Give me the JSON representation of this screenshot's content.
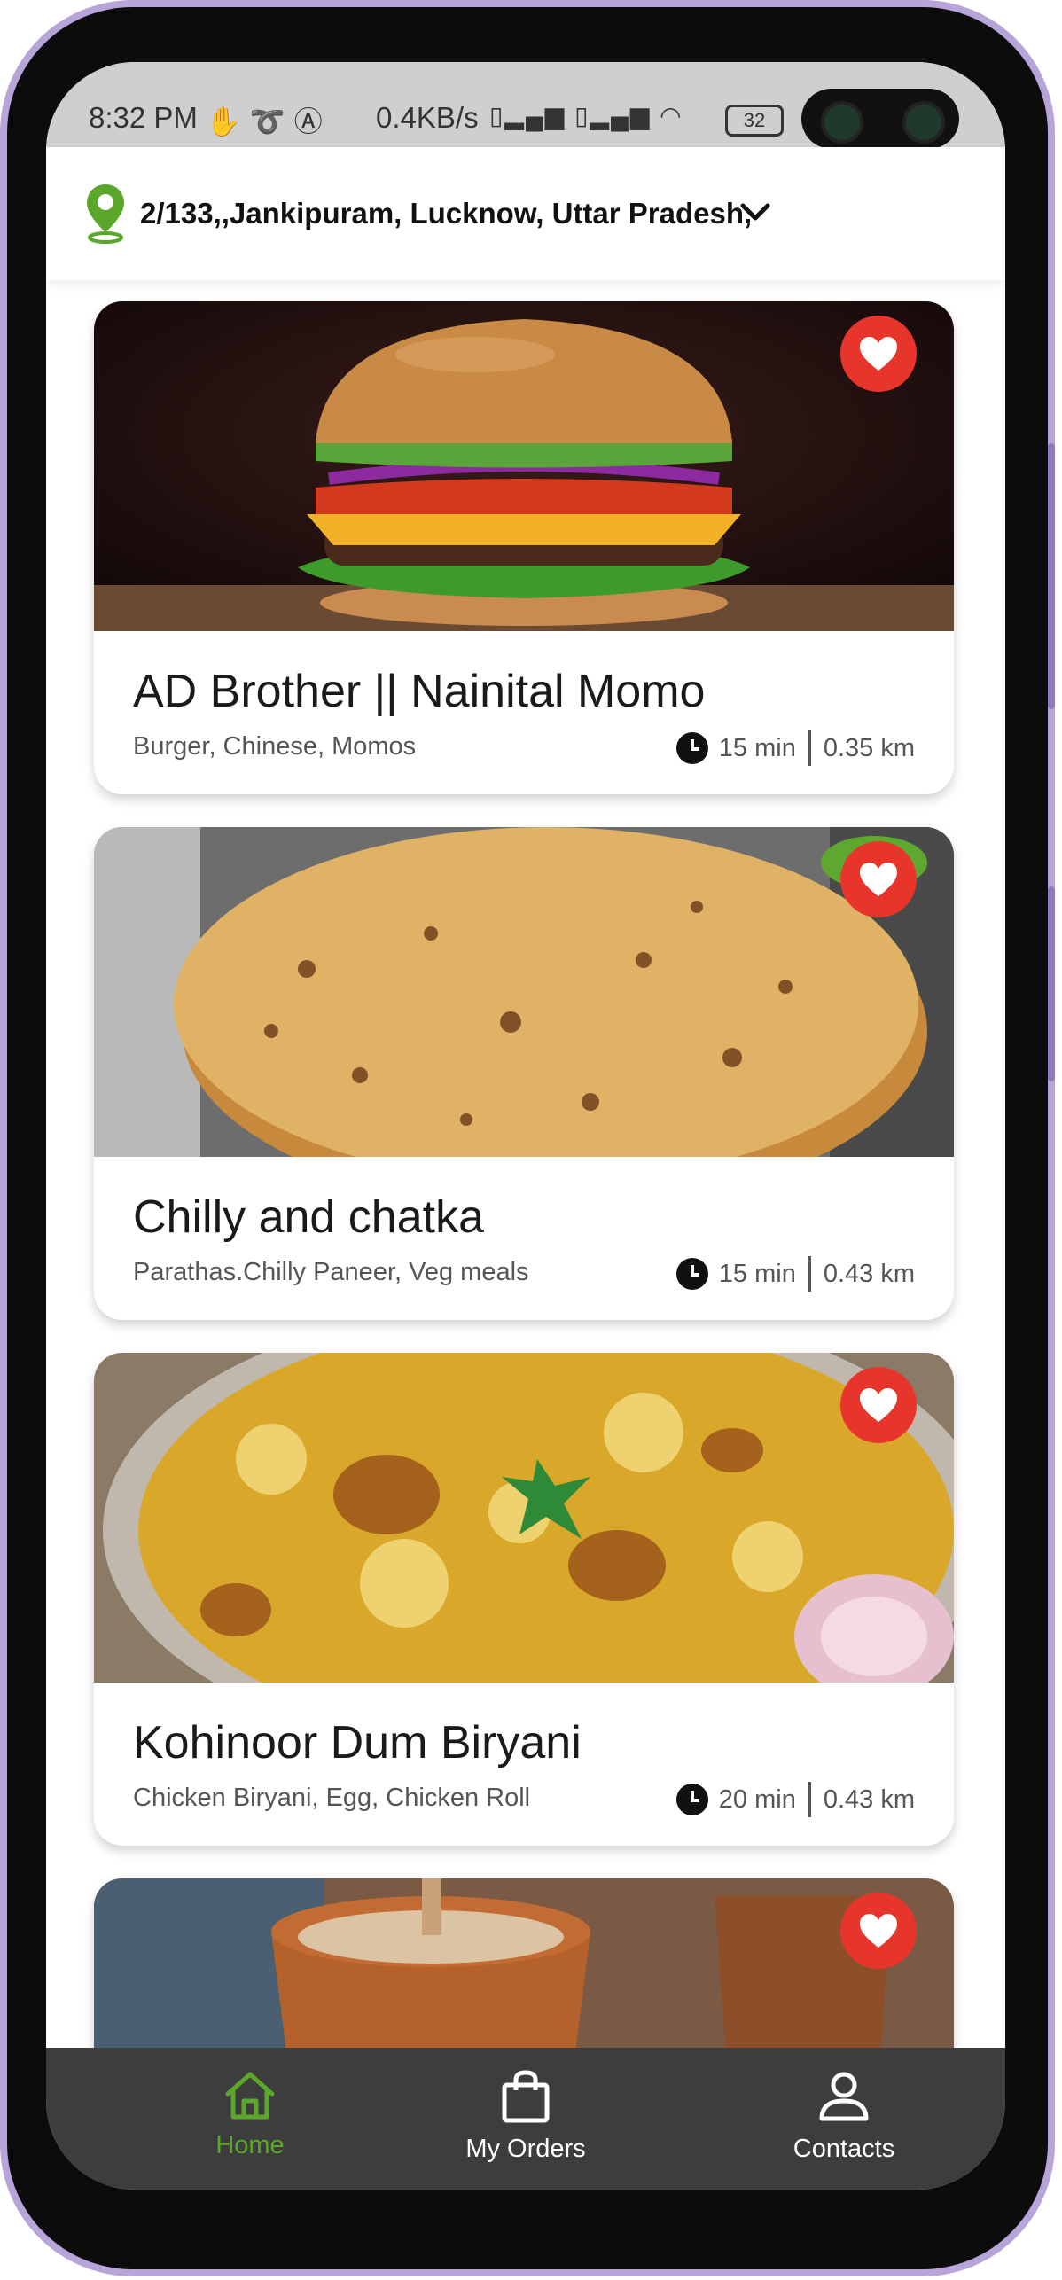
{
  "status_bar": {
    "time": "8:32 PM",
    "speed": "0.4KB/s",
    "battery": "32",
    "icons": [
      "hand-icon",
      "leaf-icon",
      "a-icon",
      "volte-icon",
      "signal-icon",
      "volte-icon",
      "signal-icon",
      "wifi-icon",
      "battery-icon"
    ]
  },
  "location": {
    "address": "2/133,,Jankipuram, Lucknow, Uttar Pradesh,",
    "pin_color": "#5aa72c"
  },
  "restaurants": [
    {
      "name": "AD Brother || Nainital Momo",
      "cuisine": "Burger, Chinese, Momos",
      "time": "15 min",
      "distance": "0.35 km",
      "image": "burger"
    },
    {
      "name": "Chilly and chatka",
      "cuisine": "Parathas.Chilly Paneer, Veg meals",
      "time": "15 min",
      "distance": "0.43 km",
      "image": "paratha"
    },
    {
      "name": "Kohinoor Dum Biryani",
      "cuisine": "Chicken Biryani, Egg, Chicken Roll",
      "time": "20 min",
      "distance": "0.43 km",
      "image": "biryani"
    },
    {
      "name": "",
      "cuisine": "",
      "time": "",
      "distance": "",
      "image": "tea"
    }
  ],
  "nav": {
    "home": "Home",
    "orders": "My Orders",
    "contacts": "Contacts",
    "active_color": "#5aa72c"
  },
  "colors": {
    "heart": "#e8352c",
    "nav_bg": "#3d3d3d"
  }
}
